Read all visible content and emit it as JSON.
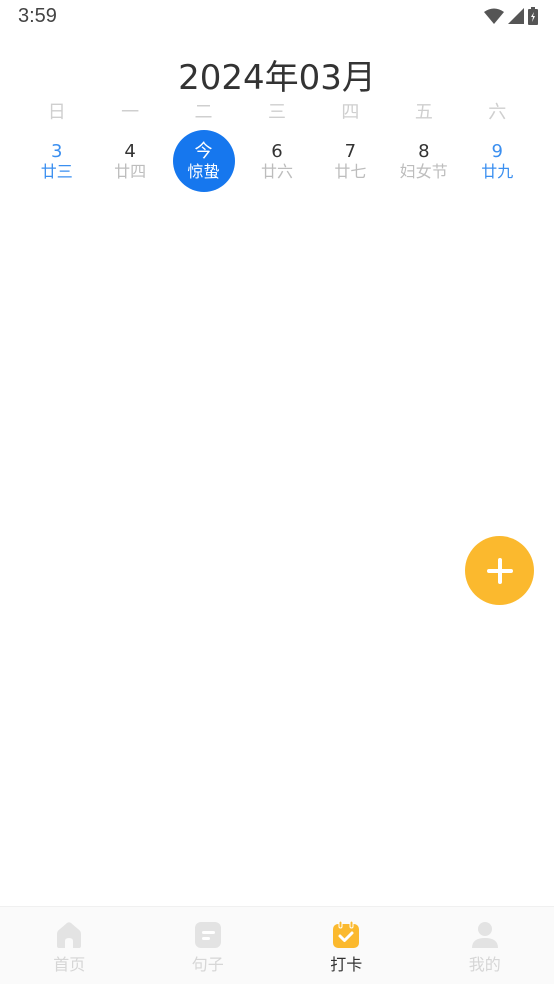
{
  "status_bar": {
    "time": "3:59"
  },
  "calendar": {
    "month_title": "2024年03月",
    "weekdays": [
      "日",
      "一",
      "二",
      "三",
      "四",
      "五",
      "六"
    ],
    "days": [
      {
        "num": "3",
        "lunar": "廿三"
      },
      {
        "num": "4",
        "lunar": "廿四"
      },
      {
        "num": "今",
        "lunar": "惊蛰"
      },
      {
        "num": "6",
        "lunar": "廿六"
      },
      {
        "num": "7",
        "lunar": "廿七"
      },
      {
        "num": "8",
        "lunar": "妇女节"
      },
      {
        "num": "9",
        "lunar": "廿九"
      }
    ]
  },
  "colors": {
    "today_bg": "#1677ee",
    "weekend_text": "#3b8ff0",
    "fab": "#fbb92e",
    "active_tab_icon": "#fbb92e"
  },
  "fab": {
    "icon": "plus-icon"
  },
  "bottom_nav": {
    "items": [
      {
        "label": "首页",
        "icon": "home-icon"
      },
      {
        "label": "句子",
        "icon": "note-icon"
      },
      {
        "label": "打卡",
        "icon": "calendar-check-icon",
        "active": true
      },
      {
        "label": "我的",
        "icon": "user-icon"
      }
    ]
  }
}
